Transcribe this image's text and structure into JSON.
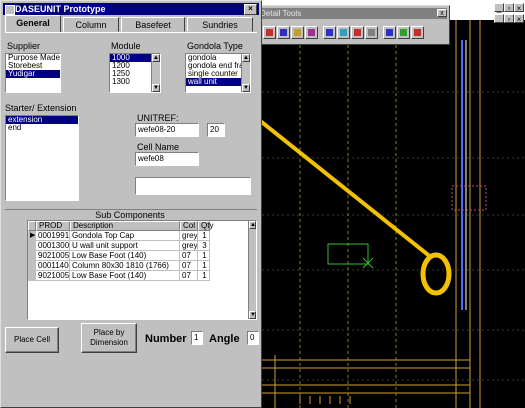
{
  "dialog": {
    "title": "DASEUNIT Prototype",
    "tabs": [
      {
        "label": "General",
        "active": true
      },
      {
        "label": "Column",
        "active": false
      },
      {
        "label": "Basefeet",
        "active": false
      },
      {
        "label": "Sundries",
        "active": false
      }
    ],
    "supplier": {
      "label": "Supplier",
      "items": [
        "Purpose Made",
        "Storebest",
        "Yudigar"
      ],
      "selected": 2
    },
    "module": {
      "label": "Module",
      "items": [
        "1000",
        "1200",
        "1250",
        "1300"
      ],
      "selected": 0
    },
    "gondola_type": {
      "label": "Gondola Type",
      "items": [
        "gondola",
        "gondola end frame",
        "single counter",
        "wall unit"
      ],
      "selected": 3
    },
    "starter_extension": {
      "label": "Starter/ Extension",
      "items": [
        "extension",
        "end"
      ],
      "selected": 0
    },
    "unitref": {
      "label": "UNITREF:",
      "value": "wefe08-20",
      "small_value": "20"
    },
    "cell_name": {
      "label": "Cell Name",
      "value": "wefe08",
      "extra_value": ""
    },
    "sub_components": {
      "label": "Sub Components",
      "columns": [
        "PROD",
        "Description",
        "Col",
        "Qty"
      ],
      "rows": [
        {
          "prod": "00019912",
          "desc": "Gondola Top Cap",
          "col": "grey",
          "qty": "1",
          "current": true
        },
        {
          "prod": "00013006",
          "desc": "U wall unit support",
          "col": "grey",
          "qty": "3",
          "current": false
        },
        {
          "prod": "90210055",
          "desc": "Low Base Foot (140)",
          "col": "07",
          "qty": "1",
          "current": false
        },
        {
          "prod": "00011400",
          "desc": "Column 80x30 1810 (1766)",
          "col": "07",
          "qty": "1",
          "current": false
        },
        {
          "prod": "90210055",
          "desc": "Low Base Foot (140)",
          "col": "07",
          "qty": "1",
          "current": false
        }
      ]
    },
    "buttons": {
      "place_cell": "Place Cell",
      "place_by_dimension_1": "Place by",
      "place_by_dimension_2": "Dimension"
    },
    "number": {
      "label": "Number",
      "value": "1"
    },
    "angle": {
      "label": "Angle",
      "value": "0"
    }
  },
  "tools_palette": {
    "title": "Detail Tools"
  },
  "colors": {
    "titlebar": "#000080",
    "chrome": "#c0c0c0",
    "cad_background": "#000000",
    "annotation": "#f2c200",
    "cad_lines": "#c8a000"
  },
  "icons": [
    "close-icon",
    "tab-icons",
    "minimize-icon",
    "restore-icon"
  ]
}
